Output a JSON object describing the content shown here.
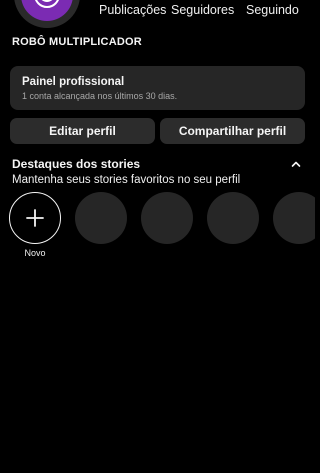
{
  "stats": {
    "posts_label": "Publicações",
    "followers_label": "Seguidores",
    "following_label": "Seguindo"
  },
  "profile": {
    "name": "ROBÔ MULTIPLICADOR"
  },
  "professional_panel": {
    "title": "Painel profissional",
    "subtitle": "1 conta alcançada nos últimos 30 dias."
  },
  "buttons": {
    "edit_profile": "Editar perfil",
    "share_profile": "Compartilhar perfil"
  },
  "highlights": {
    "title": "Destaques dos stories",
    "subtitle": "Mantenha seus stories favoritos no seu perfil",
    "new_label": "Novo",
    "collapse_icon": "chevron-up-icon",
    "add_icon": "plus-icon",
    "placeholder_count": 4
  },
  "colors": {
    "background": "#000000",
    "surface": "#262626",
    "avatar_accent": "#7b2bb3",
    "text_primary": "#f5f5f5",
    "text_secondary": "#a8a8a8"
  }
}
